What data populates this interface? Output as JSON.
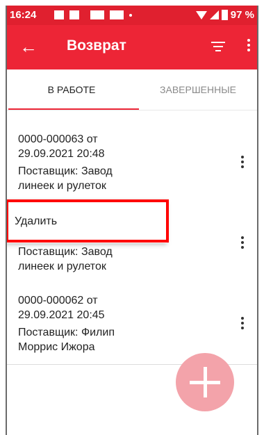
{
  "status_bar": {
    "time": "16:24",
    "battery": "97 %"
  },
  "app_bar": {
    "title": "Возврат"
  },
  "tabs": [
    {
      "label": "В РАБОТЕ",
      "active": true
    },
    {
      "label": "ЗАВЕРШЕННЫЕ",
      "active": false
    }
  ],
  "items": [
    {
      "doc": "0000-000063 от",
      "date": "29.09.2021 20:48",
      "supplier_line1": "Поставщик: Завод",
      "supplier_line2": "линеек и рулеток"
    },
    {
      "doc": "",
      "date": "",
      "supplier_line1": "Поставщик: Завод",
      "supplier_line2": "линеек и рулеток"
    },
    {
      "doc": "0000-000062 от",
      "date": "29.09.2021 20:45",
      "supplier_line1": "Поставщик: Филип",
      "supplier_line2": "Моррис Ижора"
    }
  ],
  "context_menu": {
    "delete_label": "Удалить"
  },
  "colors": {
    "accent": "#ed2536",
    "status_bar": "#e0202f",
    "fab": "#f3a3aa",
    "highlight": "#ff0000"
  },
  "icons": [
    "back-arrow-icon",
    "filter-icon",
    "more-vertical-icon",
    "add-icon"
  ]
}
